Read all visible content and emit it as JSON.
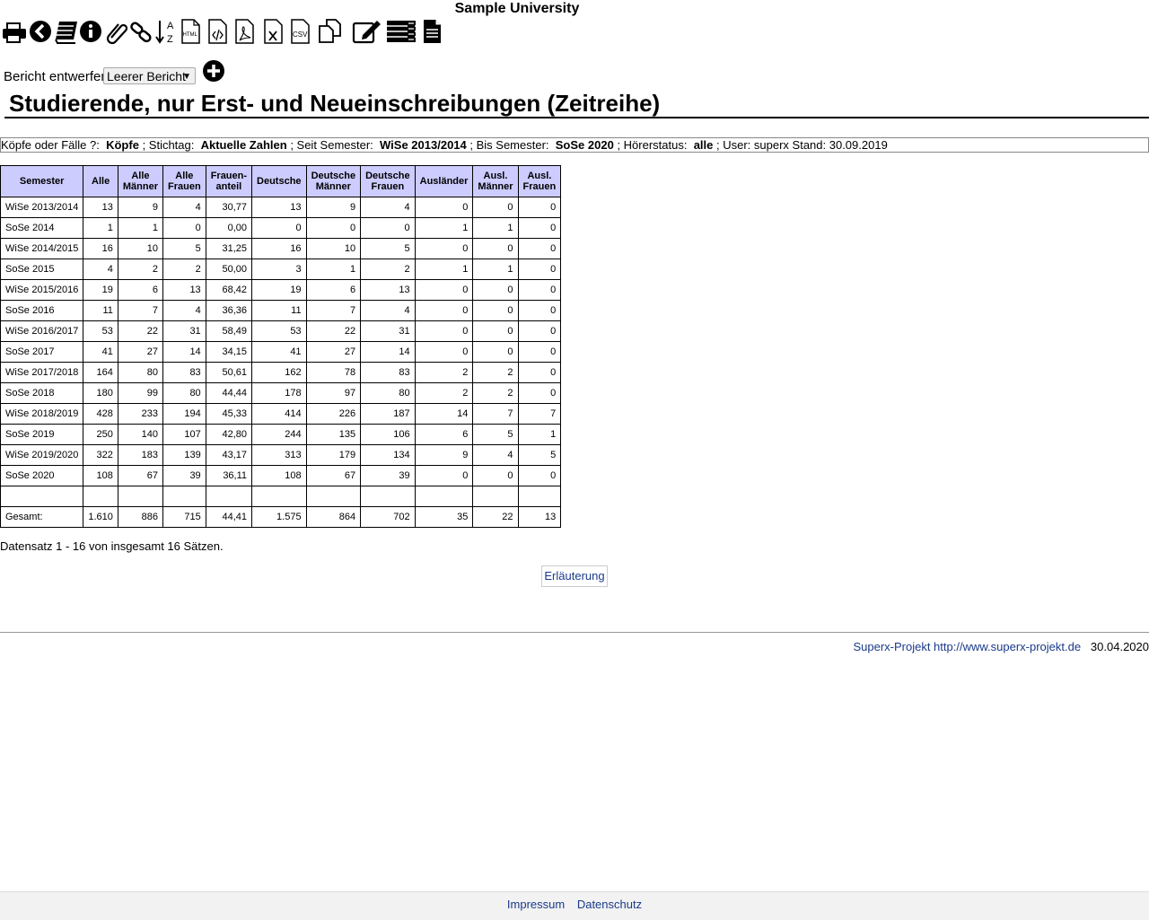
{
  "university": "Sample University",
  "toolbar": {
    "icons": [
      "printer-icon",
      "back-icon",
      "books-icon",
      "info-icon",
      "attachment-icon",
      "link-icon",
      "sort-az-icon",
      "html-export-icon",
      "xml-export-icon",
      "pdf-export-icon",
      "excel-export-icon",
      "csv-export-icon",
      "copy-icon",
      "edit-icon",
      "list-icon",
      "document-icon"
    ],
    "sort_a": "A",
    "sort_z": "Z",
    "html_label": "HTML",
    "csv_label": "CSV"
  },
  "designer": {
    "label": "Bericht entwerfen:",
    "selected": "Leerer Bericht",
    "arrow": "▼"
  },
  "title": "Studierende, nur Erst- und Neueinschreibungen (Zeitreihe)",
  "params": {
    "k1": "Köpfe oder Fälle ?:",
    "v1": "Köpfe",
    "k2": "; Stichtag:",
    "v2": "Aktuelle Zahlen",
    "k3": "; Seit Semester:",
    "v3": "WiSe 2013/2014",
    "k4": "; Bis Semester:",
    "v4": "SoSe 2020",
    "k5": "; Hörerstatus:",
    "v5": "alle",
    "k6": "; User: superx  Stand: 30.09.2019"
  },
  "table": {
    "headers": [
      [
        "Semester",
        ""
      ],
      [
        "Alle",
        ""
      ],
      [
        "Alle",
        "Männer"
      ],
      [
        "Alle",
        "Frauen"
      ],
      [
        "Frauen-",
        "anteil"
      ],
      [
        "Deutsche",
        ""
      ],
      [
        "Deutsche",
        "Männer"
      ],
      [
        "Deutsche",
        "Frauen"
      ],
      [
        "Ausländer",
        ""
      ],
      [
        "Ausl.",
        "Männer"
      ],
      [
        "Ausl.",
        "Frauen"
      ]
    ],
    "rows": [
      [
        "WiSe 2013/2014",
        "13",
        "9",
        "4",
        "30,77",
        "13",
        "9",
        "4",
        "0",
        "0",
        "0"
      ],
      [
        "SoSe 2014",
        "1",
        "1",
        "0",
        "0,00",
        "0",
        "0",
        "0",
        "1",
        "1",
        "0"
      ],
      [
        "WiSe 2014/2015",
        "16",
        "10",
        "5",
        "31,25",
        "16",
        "10",
        "5",
        "0",
        "0",
        "0"
      ],
      [
        "SoSe 2015",
        "4",
        "2",
        "2",
        "50,00",
        "3",
        "1",
        "2",
        "1",
        "1",
        "0"
      ],
      [
        "WiSe 2015/2016",
        "19",
        "6",
        "13",
        "68,42",
        "19",
        "6",
        "13",
        "0",
        "0",
        "0"
      ],
      [
        "SoSe 2016",
        "11",
        "7",
        "4",
        "36,36",
        "11",
        "7",
        "4",
        "0",
        "0",
        "0"
      ],
      [
        "WiSe 2016/2017",
        "53",
        "22",
        "31",
        "58,49",
        "53",
        "22",
        "31",
        "0",
        "0",
        "0"
      ],
      [
        "SoSe 2017",
        "41",
        "27",
        "14",
        "34,15",
        "41",
        "27",
        "14",
        "0",
        "0",
        "0"
      ],
      [
        "WiSe 2017/2018",
        "164",
        "80",
        "83",
        "50,61",
        "162",
        "78",
        "83",
        "2",
        "2",
        "0"
      ],
      [
        "SoSe 2018",
        "180",
        "99",
        "80",
        "44,44",
        "178",
        "97",
        "80",
        "2",
        "2",
        "0"
      ],
      [
        "WiSe 2018/2019",
        "428",
        "233",
        "194",
        "45,33",
        "414",
        "226",
        "187",
        "14",
        "7",
        "7"
      ],
      [
        "SoSe 2019",
        "250",
        "140",
        "107",
        "42,80",
        "244",
        "135",
        "106",
        "6",
        "5",
        "1"
      ],
      [
        "WiSe 2019/2020",
        "322",
        "183",
        "139",
        "43,17",
        "313",
        "179",
        "134",
        "9",
        "4",
        "5"
      ],
      [
        "SoSe 2020",
        "108",
        "67",
        "39",
        "36,11",
        "108",
        "67",
        "39",
        "0",
        "0",
        "0"
      ],
      [
        "",
        "",
        "",
        "",
        "",
        "",
        "",
        "",
        "",
        "",
        ""
      ],
      [
        "Gesamt:",
        "1.610",
        "886",
        "715",
        "44,41",
        "1.575",
        "864",
        "702",
        "35",
        "22",
        "13"
      ]
    ]
  },
  "record_count": "Datensatz 1 - 16 von insgesamt 16 Sätzen.",
  "erlaeuterung": "Erläuterung",
  "credit": {
    "link": "Superx-Projekt http://www.superx-projekt.de",
    "date": "30.04.2020"
  },
  "bottom": {
    "impressum": "Impressum",
    "datenschutz": "Datenschutz"
  }
}
